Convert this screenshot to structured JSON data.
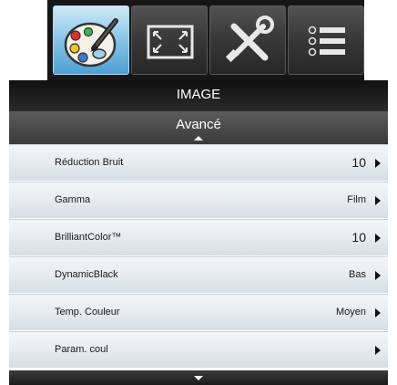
{
  "tabs": [
    {
      "icon": "palette-icon",
      "active": true
    },
    {
      "icon": "screen-expand-icon",
      "active": false
    },
    {
      "icon": "tools-icon",
      "active": false
    },
    {
      "icon": "options-list-icon",
      "active": false
    }
  ],
  "header": {
    "title": "IMAGE",
    "subtitle": "Avancé"
  },
  "menu": {
    "items": [
      {
        "label": "Réduction Bruit",
        "value": "10"
      },
      {
        "label": "Gamma",
        "value": "Film"
      },
      {
        "label": "BrilliantColor™",
        "value": "10"
      },
      {
        "label": "DynamicBlack",
        "value": "Bas"
      },
      {
        "label": "Temp. Couleur",
        "value": "Moyen"
      },
      {
        "label": "Param. coul",
        "value": ""
      }
    ]
  },
  "colors": {
    "active_tab": "#8cc8ea",
    "tab_bar": "#161616",
    "row_background": "#e6ecf0"
  }
}
